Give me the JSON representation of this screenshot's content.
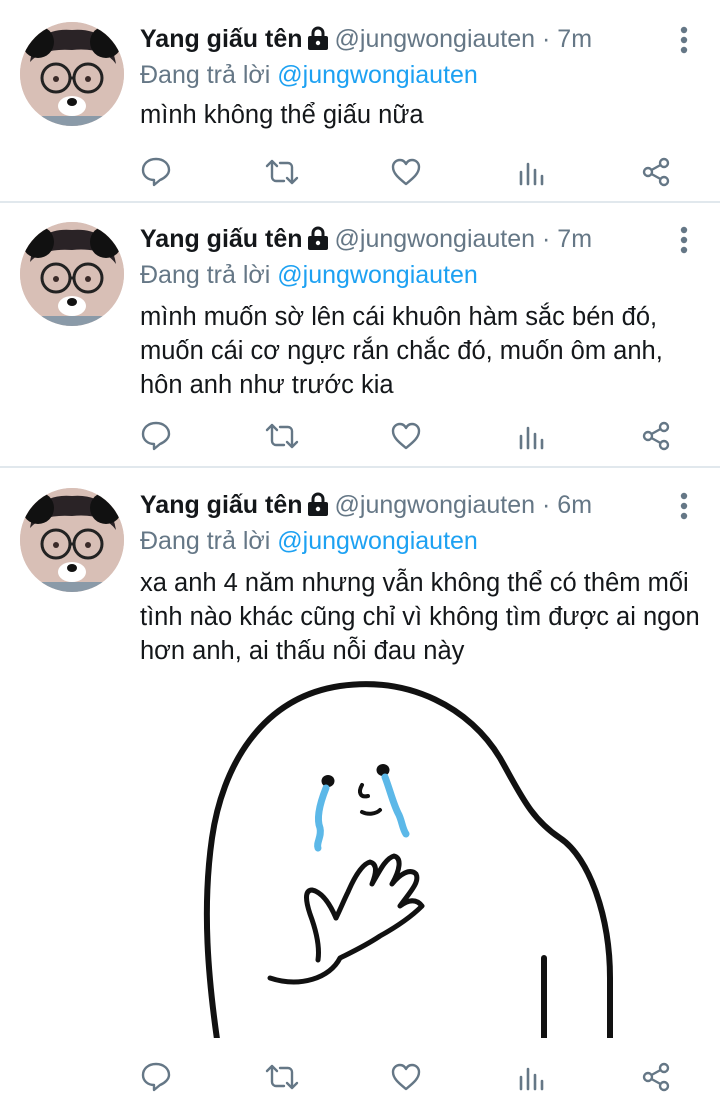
{
  "tweets": [
    {
      "author": {
        "name": "Yang giấu tên",
        "handle": "@jungwongiauten"
      },
      "dot": "·",
      "time": "7m",
      "reply_prefix": "Đang trả lời",
      "reply_to": "@jungwongiauten",
      "text": "mình không thể giấu nữa"
    },
    {
      "author": {
        "name": "Yang giấu tên",
        "handle": "@jungwongiauten"
      },
      "dot": "·",
      "time": "7m",
      "reply_prefix": "Đang trả lời",
      "reply_to": "@jungwongiauten",
      "text": "mình muốn sờ lên cái khuôn hàm sắc bén đó, muốn cái cơ ngực rắn chắc đó, muốn ôm anh, hôn anh như trước kia"
    },
    {
      "author": {
        "name": "Yang giấu tên",
        "handle": "@jungwongiauten"
      },
      "dot": "·",
      "time": "6m",
      "reply_prefix": "Đang trả lời",
      "reply_to": "@jungwongiauten",
      "text": "xa anh 4 năm nhưng vẫn không thể có thêm mối tình nào khác cũng chỉ vì không tìm được ai ngon hơn anh, ai thấu nỗi đau này",
      "media": {
        "kind": "crying-blob-sticker"
      }
    }
  ],
  "colors": {
    "text": "#14171a",
    "secondary": "#657786",
    "accent": "#1da1f2",
    "divider": "#e1e8ed",
    "tear": "#5cb8e8"
  },
  "icons": [
    "lock-icon",
    "more-vertical-icon",
    "reply-icon",
    "retweet-icon",
    "like-icon",
    "analytics-icon",
    "share-icon"
  ]
}
